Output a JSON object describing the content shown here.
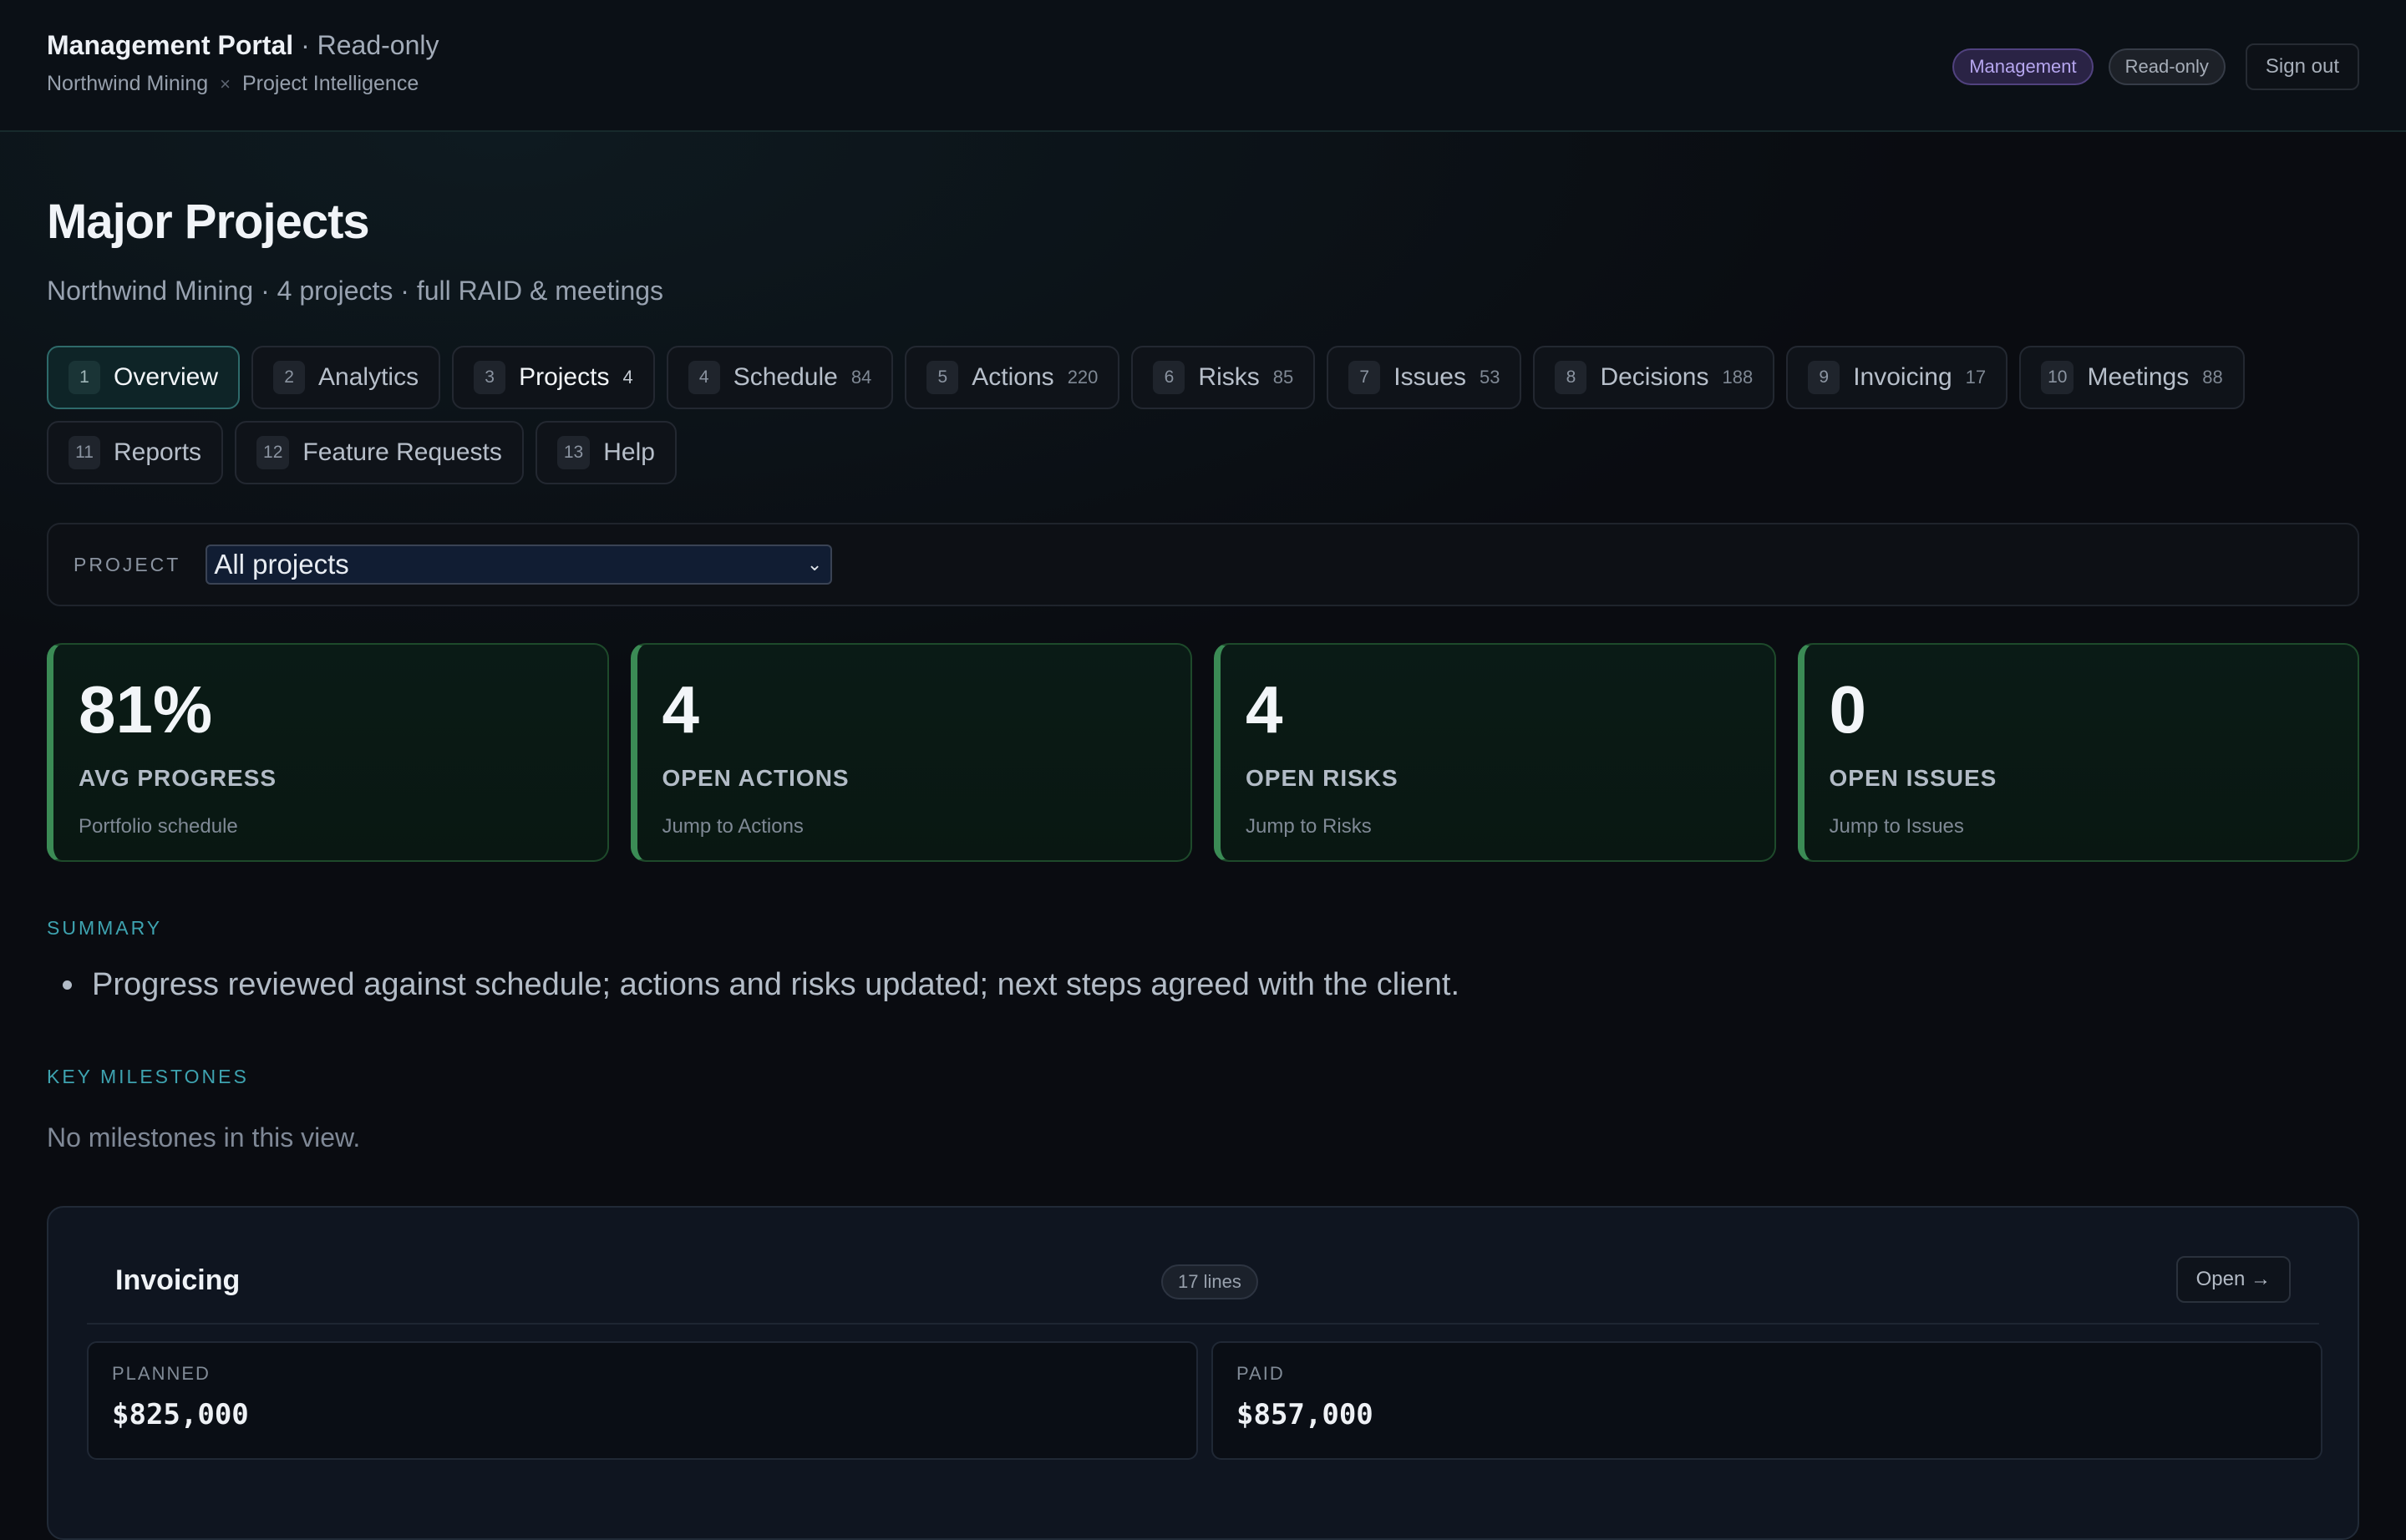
{
  "header": {
    "app_title": "Management Portal",
    "app_mode": " · Read-only",
    "breadcrumb": [
      "Northwind Mining",
      "Project Intelligence"
    ],
    "breadcrumb_sep": "×",
    "badges": {
      "role": "Management",
      "access": "Read-only"
    },
    "signout_label": "Sign out"
  },
  "page": {
    "title": "Major Projects",
    "subtitle": "Northwind Mining · 4 projects · full RAID & meetings"
  },
  "tabs": [
    {
      "num": "1",
      "label": "Overview",
      "count": "",
      "active": true
    },
    {
      "num": "2",
      "label": "Analytics",
      "count": ""
    },
    {
      "num": "3",
      "label": "Projects",
      "count": "4"
    },
    {
      "num": "4",
      "label": "Schedule",
      "count": "84"
    },
    {
      "num": "5",
      "label": "Actions",
      "count": "220"
    },
    {
      "num": "6",
      "label": "Risks",
      "count": "85"
    },
    {
      "num": "7",
      "label": "Issues",
      "count": "53"
    },
    {
      "num": "8",
      "label": "Decisions",
      "count": "188"
    },
    {
      "num": "9",
      "label": "Invoicing",
      "count": "17"
    },
    {
      "num": "10",
      "label": "Meetings",
      "count": "88"
    },
    {
      "num": "11",
      "label": "Reports",
      "count": ""
    },
    {
      "num": "12",
      "label": "Feature Requests",
      "count": ""
    },
    {
      "num": "13",
      "label": "Help",
      "count": ""
    }
  ],
  "filter": {
    "label": "PROJECT",
    "selected": "All projects"
  },
  "kpis": [
    {
      "value": "81%",
      "label": "AVG PROGRESS",
      "note": "Portfolio schedule"
    },
    {
      "value": "4",
      "label": "OPEN ACTIONS",
      "note": "Jump to Actions"
    },
    {
      "value": "4",
      "label": "OPEN RISKS",
      "note": "Jump to Risks"
    },
    {
      "value": "0",
      "label": "OPEN ISSUES",
      "note": "Jump to Issues"
    }
  ],
  "summary": {
    "heading": "SUMMARY",
    "items": [
      "Progress reviewed against schedule; actions and risks updated; next steps agreed with the client."
    ]
  },
  "milestones": {
    "heading": "KEY MILESTONES",
    "empty": "No milestones in this view."
  },
  "invoicing": {
    "title": "Invoicing",
    "badge": "17 lines",
    "open_label": "Open →",
    "planned": {
      "label": "PLANNED",
      "value": "$825,000"
    },
    "paid": {
      "label": "PAID",
      "value": "$857,000"
    }
  },
  "colors": {
    "accent_teal": "#3ea3b0",
    "kpi_green": "#3b8b55",
    "role_purple": "#b6a6ef"
  }
}
